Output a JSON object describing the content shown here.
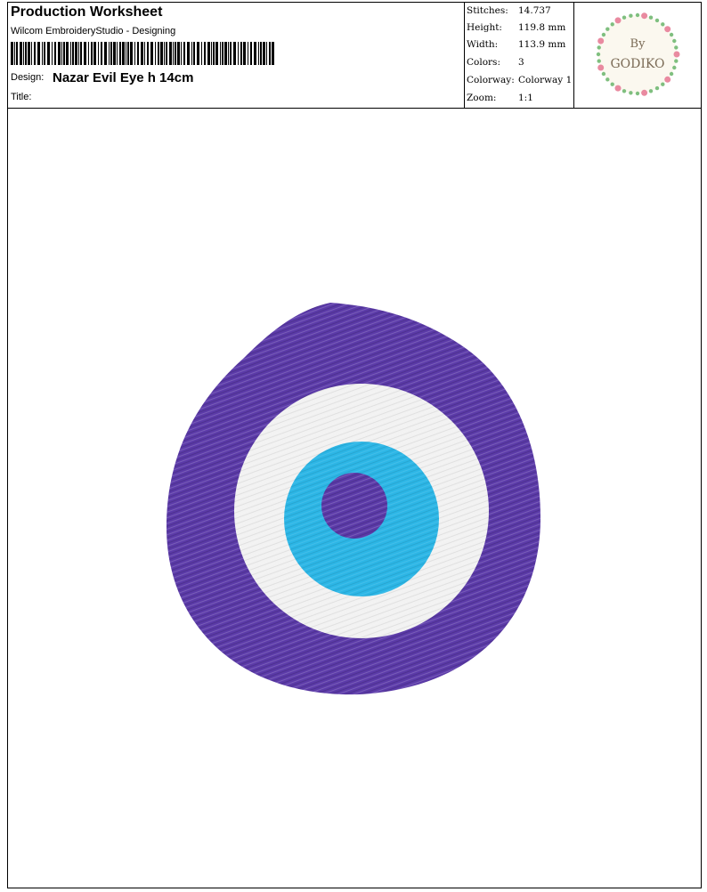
{
  "header": {
    "title": "Production Worksheet",
    "software": "Wilcom EmbroideryStudio - Designing",
    "design_label": "Design:",
    "design_name": "Nazar Evil Eye h 14cm",
    "title_label": "Title:"
  },
  "stats": [
    {
      "key": "Stitches:",
      "value": "14.737"
    },
    {
      "key": "Height:",
      "value": "119.8 mm"
    },
    {
      "key": "Width:",
      "value": "113.9 mm"
    },
    {
      "key": "Colors:",
      "value": "3"
    },
    {
      "key": "Colorway:",
      "value": "Colorway 1"
    },
    {
      "key": "Zoom:",
      "value": "1:1"
    }
  ],
  "logo": {
    "line1": "By",
    "line2": "GODIKO"
  },
  "colors": {
    "outer": "#5b3aa8",
    "white": "#f2f2f2",
    "iris": "#2cb6e6",
    "pupil": "#5b3aa8",
    "wreath_leaf": "#7fbf7f",
    "wreath_flower": "#e98aa0"
  }
}
